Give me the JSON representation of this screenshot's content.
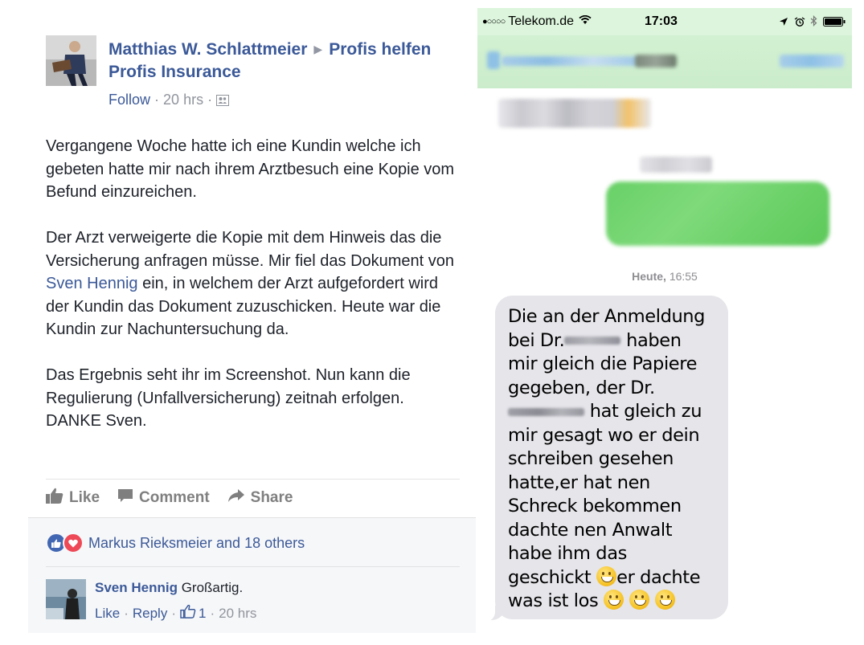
{
  "post": {
    "author": "Matthias W. Schlattmeier",
    "group_part1": "Profis helfen",
    "group_part2": "Profis Insurance",
    "follow": "Follow",
    "time": "20 hrs",
    "dot": "·",
    "paragraph1": "Vergangene Woche hatte ich eine Kundin welche ich gebeten hatte mir nach ihrem Arztbesuch eine Kopie vom Befund einzureichen.",
    "paragraph2_before": "Der Arzt verweigerte die Kopie mit dem Hinweis das die Versicherung anfragen müsse. Mir fiel das Dokument von ",
    "paragraph2_mention": "Sven Hennig",
    "paragraph2_after": " ein, in welchem der Arzt aufgefordert wird der Kundin das Dokument zuzuschicken. Heute war die Kundin zur Nachuntersuchung da.",
    "paragraph3": "Das Ergebnis seht ihr im Screenshot. Nun kann die Regulierung (Unfallversicherung) zeitnah erfolgen. DANKE Sven."
  },
  "actions": {
    "like": "Like",
    "comment": "Comment",
    "share": "Share"
  },
  "reactions": {
    "summary": "Markus Rieksmeier and 18 others"
  },
  "comment": {
    "author": "Sven Hennig",
    "text": "Großartig.",
    "like": "Like",
    "reply": "Reply",
    "like_count": "1",
    "time": "20 hrs",
    "dot": "·"
  },
  "phone": {
    "carrier": "Telekom.de",
    "signal_dots": "●○○○○",
    "time": "17:03",
    "timestamp_day": "Heute,",
    "timestamp_time": "16:55",
    "message": {
      "l1": "Die an der Anmeldung",
      "l2_a": "bei Dr.",
      "l2_b": "haben",
      "l3": "mir gleich die Papiere",
      "l4": "gegeben, der Dr.",
      "l5_b": "hat gleich zu",
      "l6": "mir gesagt wo er dein",
      "l7": "schreiben gesehen",
      "l8": "hatte,er hat nen",
      "l9": "Schreck bekommen",
      "l10": "dachte nen Anwalt",
      "l11": "habe ihm das",
      "l12_a": "geschickt",
      "l12_b": "er dachte",
      "l13": "was ist los"
    }
  }
}
